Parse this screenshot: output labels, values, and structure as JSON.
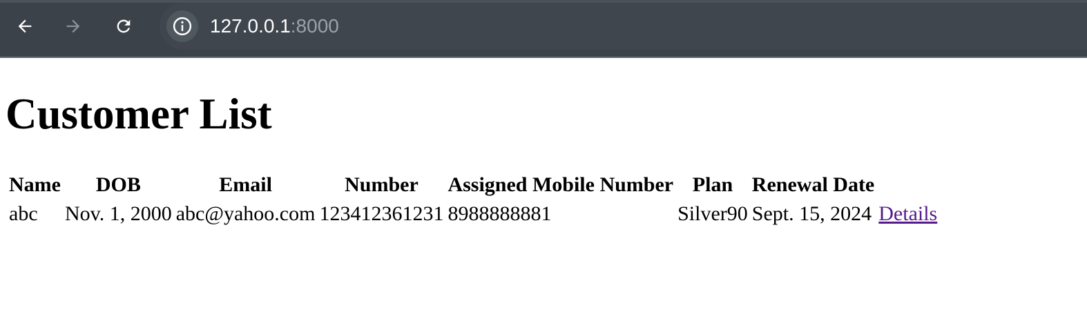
{
  "browser": {
    "url_host": "127.0.0.1",
    "url_port": ":8000",
    "icons": [
      "back-arrow-icon",
      "forward-arrow-icon",
      "reload-icon",
      "site-info-icon"
    ]
  },
  "page": {
    "title": "Customer List"
  },
  "table": {
    "headers": [
      "Name",
      "DOB",
      "Email",
      "Number",
      "Assigned Mobile Number",
      "Plan",
      "Renewal Date"
    ],
    "rows": [
      {
        "name": "abc",
        "dob": "Nov. 1, 2000",
        "email": "abc@yahoo.com",
        "number": "123412361231",
        "assigned_mobile_number": "8988888881",
        "plan": "Silver90",
        "renewal_date": "Sept. 15, 2024",
        "details_link": "Details"
      }
    ]
  },
  "colors": {
    "toolbar_bg": "#3c4249",
    "link_visited": "#551a8b"
  }
}
